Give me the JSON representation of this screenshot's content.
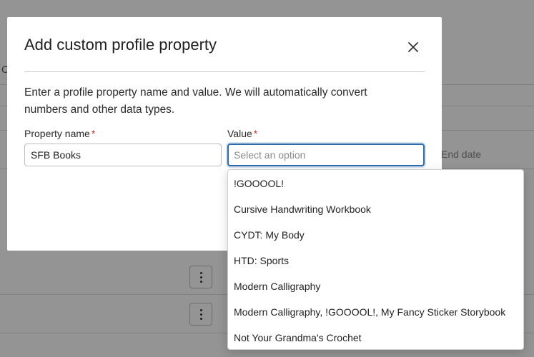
{
  "background": {
    "partial_label": "C",
    "end_date_placeholder": "End date"
  },
  "modal": {
    "title": "Add custom profile property",
    "description": "Enter a profile property name and value. We will automatically convert numbers and other data types.",
    "property_name_label": "Property name",
    "property_name_value": "SFB Books",
    "value_label": "Value",
    "value_placeholder": "Select an option",
    "required_marker": "*"
  },
  "dropdown": {
    "options": [
      "!GOOOOL!",
      "Cursive Handwriting Workbook",
      "CYDT: My Body",
      "HTD: Sports",
      "Modern Calligraphy",
      "Modern Calligraphy, !GOOOOL!, My Fancy Sticker Storybook",
      "Not Your Grandma's Crochet"
    ]
  },
  "icons": {
    "close": "close-icon",
    "row_menu": "kebab-menu-icon"
  }
}
